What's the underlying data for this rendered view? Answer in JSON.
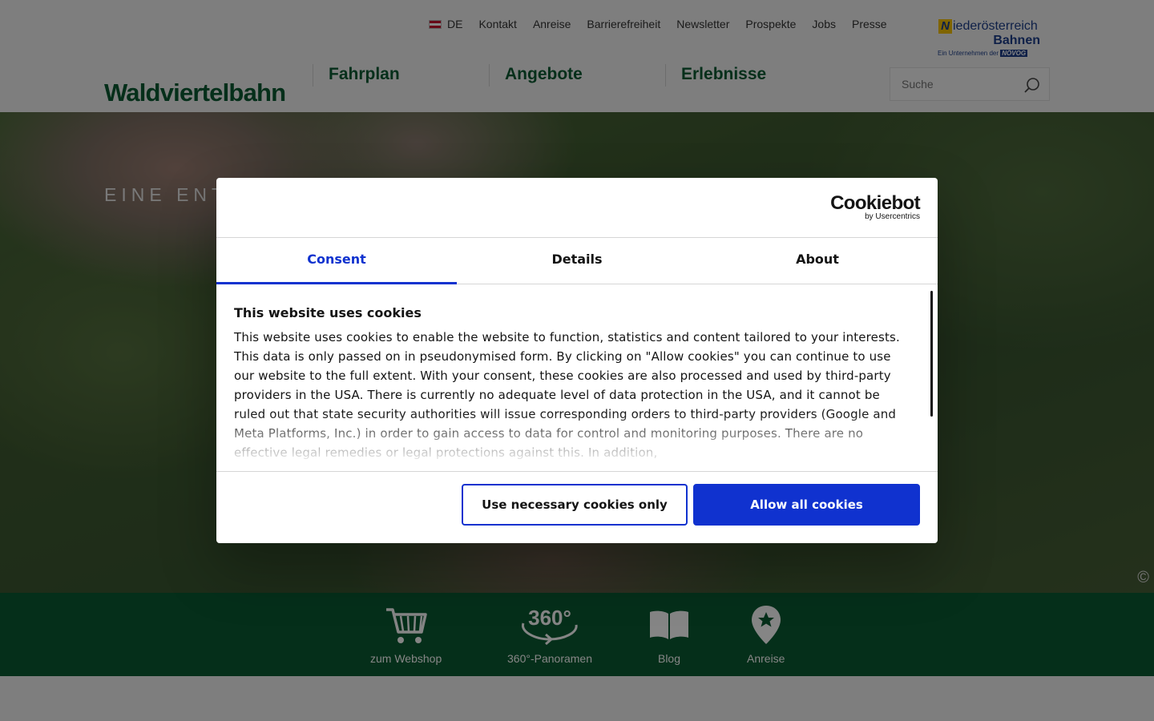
{
  "header": {
    "language": "DE",
    "top_links": [
      "Kontakt",
      "Anreise",
      "Barrierefreiheit",
      "Newsletter",
      "Prospekte",
      "Jobs",
      "Presse"
    ],
    "brand": "Waldviertelbahn",
    "main_nav": [
      "Fahrplan",
      "Angebote",
      "Erlebnisse"
    ],
    "partner_logo": {
      "line1": "iederösterreich",
      "line2": "Bahnen",
      "line3": "Ein Unternehmen der",
      "line3_mark": "NÖVOG"
    },
    "search": {
      "placeholder": "Suche",
      "icon": "search-icon"
    }
  },
  "hero": {
    "text": "EINE ENT",
    "copyright_symbol": "©"
  },
  "quickbar": {
    "items": [
      {
        "label": "zum Webshop",
        "icon": "cart-icon"
      },
      {
        "label": "360°-Panoramen",
        "icon": "panorama-360-icon"
      },
      {
        "label": "Blog",
        "icon": "book-icon"
      },
      {
        "label": "Anreise",
        "icon": "map-pin-icon"
      }
    ]
  },
  "cookie_dialog": {
    "logo_main": "Cookiebot",
    "logo_sub": "by Usercentrics",
    "tabs": [
      "Consent",
      "Details",
      "About"
    ],
    "active_tab": "Consent",
    "heading": "This website uses cookies",
    "body": "This website uses cookies to enable the website to function, statistics and content tailored to your interests. This data is only passed on in pseudonymised form. By clicking on \"Allow cookies\" you can continue to use our website to the full extent. With your consent, these cookies are also processed and used by third-party providers in the USA. There is currently no adequate level of data protection in the USA, and it cannot be ruled out that state security authorities will issue corresponding orders to third-party providers (Google and Meta Platforms, Inc.) in order to gain access to data for control and monitoring purposes. There are no effective legal remedies or legal protections against this. In addition,",
    "buttons": {
      "necessary": "Use necessary cookies only",
      "allow_all": "Allow all cookies"
    }
  },
  "colors": {
    "brand_green": "#0b5a33",
    "cookiebot_blue": "#1032cf",
    "partner_blue": "#1d3f8a"
  }
}
